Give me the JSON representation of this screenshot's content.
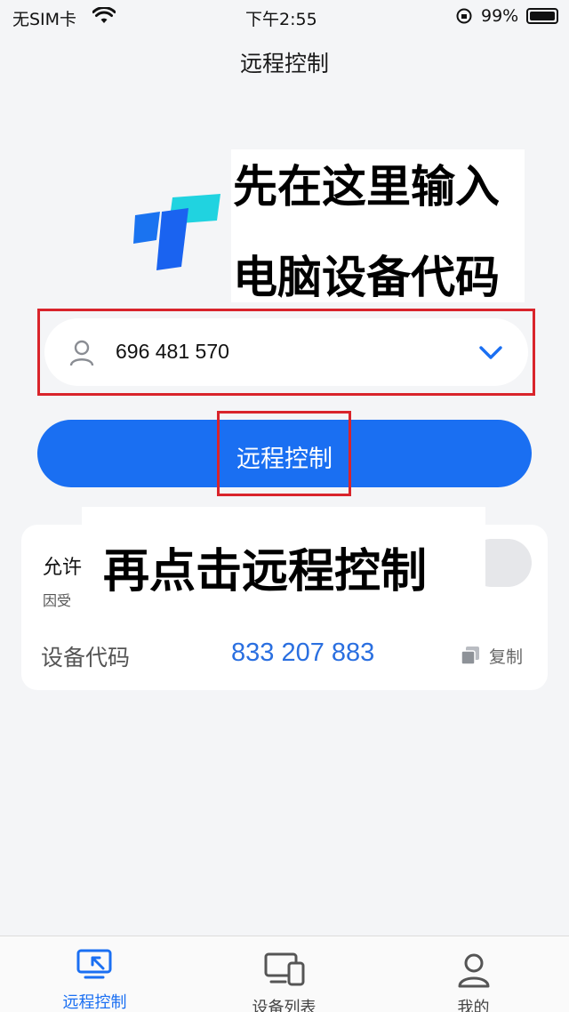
{
  "status_bar": {
    "carrier": "无SIM卡",
    "wifi_icon": "wifi-icon",
    "time": "下午2:55",
    "battery_percent": "99%"
  },
  "nav": {
    "title": "远程控制"
  },
  "logo": {
    "text": "T",
    "icon": "todesk-logo-icon"
  },
  "annotations": {
    "line1": "先在这里输入",
    "line2": "电脑设备代码",
    "line3": "再点击远程控制"
  },
  "device_input": {
    "value": "696 481 570",
    "user_icon": "user-icon",
    "dropdown_icon": "chevron-down-icon"
  },
  "primary_button": {
    "label": "远程控制"
  },
  "card": {
    "allow_title_partial": "允许",
    "allow_desc_partial": "因受",
    "device_code_label": "设备代码",
    "device_code_value": "833 207 883",
    "copy_label": "复制"
  },
  "tabs": [
    {
      "label": "远程控制",
      "icon": "remote-control-icon",
      "active": true
    },
    {
      "label": "设备列表",
      "icon": "device-list-icon",
      "active": false
    },
    {
      "label": "我的",
      "icon": "profile-icon",
      "active": false
    }
  ],
  "colors": {
    "accent": "#1a6ff2",
    "annotation_red": "#d9242b",
    "device_code_blue": "#2a6fe0"
  }
}
